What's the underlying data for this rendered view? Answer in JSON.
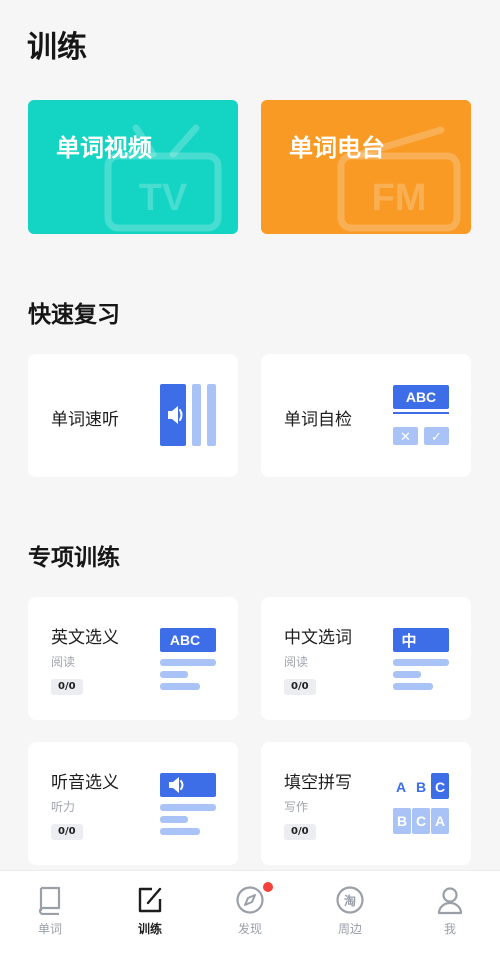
{
  "page": {
    "title": "训练"
  },
  "hero": {
    "video": {
      "label": "单词视频",
      "badge": "TV",
      "color": "#14d4c3"
    },
    "radio": {
      "label": "单词电台",
      "badge": "FM",
      "color": "#f89a24"
    }
  },
  "quick_review": {
    "title": "快速复习",
    "items": [
      {
        "label": "单词速听",
        "icon": "speaker-icon"
      },
      {
        "label": "单词自检",
        "icon": "check-quiz-icon",
        "badge": "ABC",
        "marks": [
          "✕",
          "✓"
        ]
      }
    ]
  },
  "special": {
    "title": "专项训练",
    "items": [
      {
        "label": "英文选义",
        "sub": "阅读",
        "progress": "0/0",
        "art": "ABC"
      },
      {
        "label": "中文选词",
        "sub": "阅读",
        "progress": "0/0",
        "art": "中"
      },
      {
        "label": "听音选义",
        "sub": "听力",
        "progress": "0/0",
        "art": "speaker"
      },
      {
        "label": "填空拼写",
        "sub": "写作",
        "progress": "0/0",
        "letters_top": [
          "A",
          "B",
          "C"
        ],
        "letters_bottom": [
          "B",
          "C",
          "A"
        ]
      }
    ]
  },
  "tabbar": {
    "items": [
      {
        "label": "单词",
        "icon": "book-icon"
      },
      {
        "label": "训练",
        "icon": "edit-icon",
        "active": true
      },
      {
        "label": "发现",
        "icon": "compass-icon",
        "has_dot": true
      },
      {
        "label": "周边",
        "icon": "taobao-icon"
      },
      {
        "label": "我",
        "icon": "profile-icon"
      }
    ]
  },
  "colors": {
    "accent_blue": "#3d6ee8",
    "light_blue": "#a9c3f6",
    "dot": "#f2423b"
  }
}
